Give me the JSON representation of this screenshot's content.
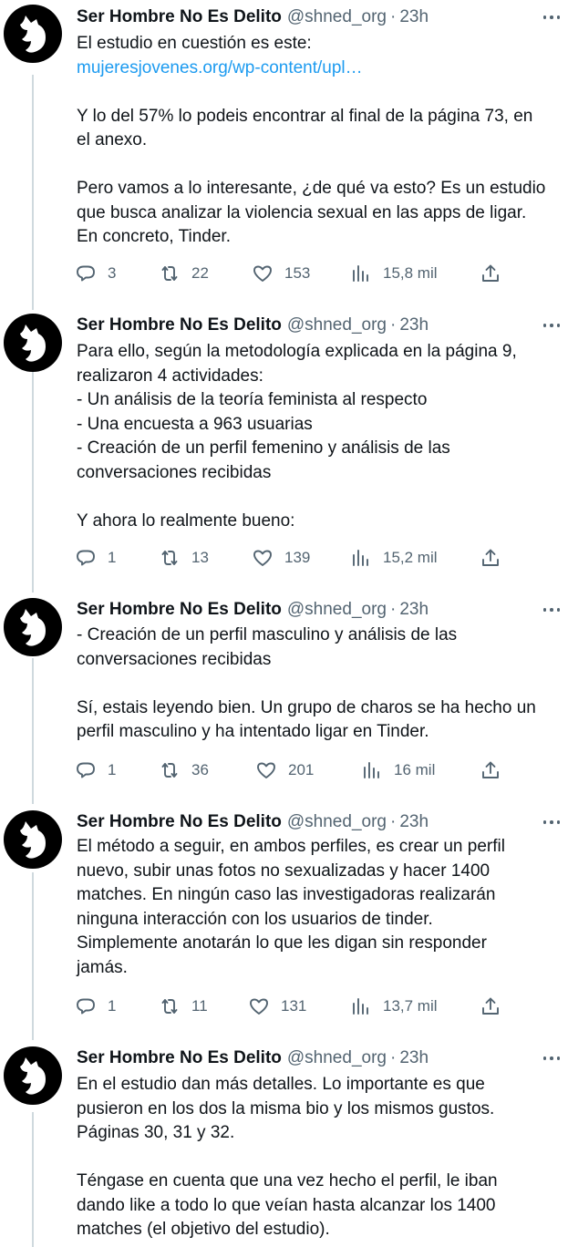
{
  "author": {
    "name": "Ser Hombre No Es Delito",
    "handle": "@shned_org",
    "separator": "·"
  },
  "tweets": [
    {
      "time": "23h",
      "lines": [
        "El estudio en cuestión es este:",
        "mujeresjovenes.org/wp-content/upl…",
        "",
        "Y lo del 57% lo podeis encontrar al final de la página 73, en",
        "el anexo.",
        "",
        "Pero vamos a lo interesante, ¿de qué va esto? Es un estudio",
        "que busca analizar la violencia sexual en las apps de ligar.",
        "En concreto, Tinder."
      ],
      "replies": "3",
      "retweets": "22",
      "likes": "153",
      "views": "15,8 mil"
    },
    {
      "time": "23h",
      "lines": [
        "Para ello, según la metodología explicada en la página 9,",
        "realizaron 4 actividades:",
        "- Un análisis de la teoría feminista al respecto",
        "- Una encuesta a 963 usuarias",
        "- Creación de un perfil femenino y análisis de las",
        "conversaciones recibidas",
        "",
        "Y ahora lo realmente bueno:"
      ],
      "replies": "1",
      "retweets": "13",
      "likes": "139",
      "views": "15,2 mil"
    },
    {
      "time": "23h",
      "lines": [
        "- Creación de un perfil masculino y análisis de las",
        "conversaciones recibidas",
        "",
        "Sí, estais leyendo bien. Un grupo de charos se ha hecho un",
        "perfil masculino y ha intentado ligar en Tinder."
      ],
      "replies": "1",
      "retweets": "36",
      "likes": "201",
      "views": "16 mil"
    },
    {
      "time": "23h",
      "lines": [
        "El método a seguir, en ambos perfiles, es crear un perfil",
        "nuevo, subir unas fotos no sexualizadas y hacer 1400",
        "matches. En ningún caso las investigadoras realizarán",
        "ninguna interacción con los usuarios de tinder.",
        "Simplemente anotarán lo que les digan sin responder",
        "jamás."
      ],
      "replies": "1",
      "retweets": "11",
      "likes": "131",
      "views": "13,7 mil"
    },
    {
      "time": "23h",
      "lines": [
        "En el estudio dan más detalles. Lo importante es que",
        "pusieron en los dos la misma bio y los mismos gustos.",
        "Páginas 30, 31 y 32.",
        "",
        "Téngase en cuenta que una vez hecho el perfil, le iban",
        "dando like a todo lo que veían hasta alcanzar los 1400",
        "matches (el objetivo del estudio)."
      ]
    }
  ]
}
